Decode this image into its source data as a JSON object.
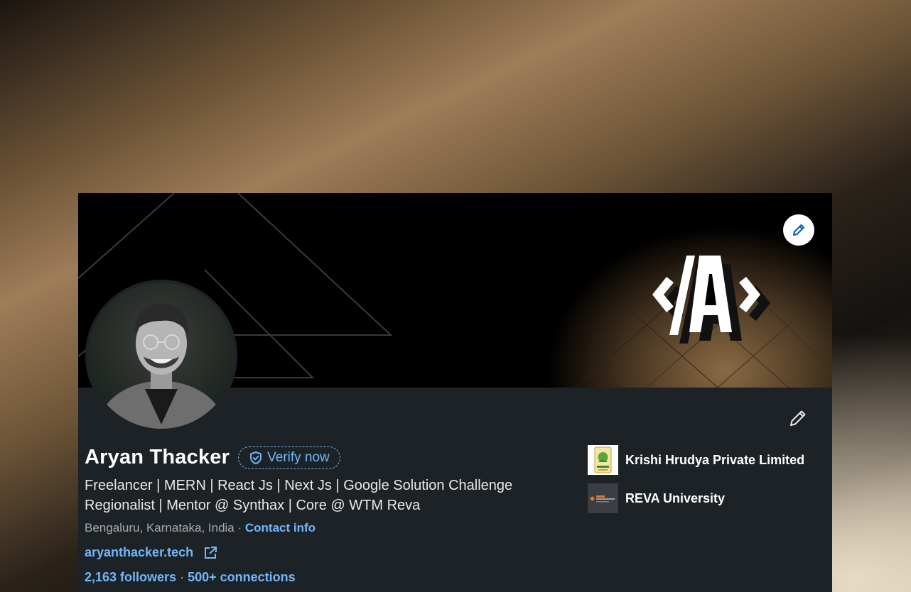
{
  "profile": {
    "name": "Aryan Thacker",
    "verify_label": "Verify now",
    "headline": "Freelancer | MERN | React Js | Next Js | Google Solution Challenge Regionalist | Mentor @ Synthax | Core @ WTM Reva",
    "location": "Bengaluru, Karnataka, India",
    "separator": " · ",
    "contact_label": "Contact info",
    "website": "aryanthacker.tech",
    "followers": "2,163 followers",
    "connections": "500+ connections"
  },
  "banner": {
    "logo_text": "</A>"
  },
  "organizations": [
    {
      "name": "Krishi Hrudya Private Limited",
      "logo": "krishi-logo"
    },
    {
      "name": "REVA University",
      "logo": "reva-logo"
    }
  ],
  "colors": {
    "card_bg": "#1d2226",
    "link": "#71b7fb",
    "text_primary": "#ffffff",
    "text_secondary": "#a9aaab"
  },
  "icons": {
    "banner_edit": "pencil-icon",
    "intro_edit": "pencil-icon",
    "verify": "shield-check-icon",
    "website": "external-link-icon"
  }
}
